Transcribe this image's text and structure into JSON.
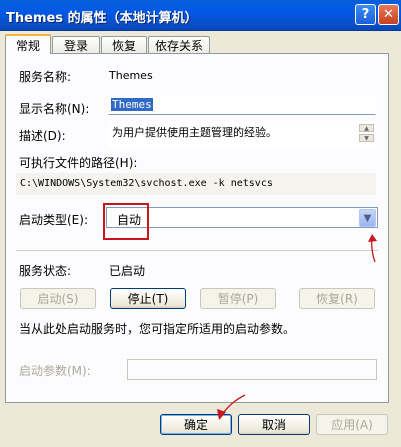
{
  "window": {
    "title": "Themes 的属性（本地计算机）",
    "help_glyph": "?",
    "close_glyph": "✕"
  },
  "tabs": [
    {
      "label": "常规",
      "active": true
    },
    {
      "label": "登录",
      "active": false
    },
    {
      "label": "恢复",
      "active": false
    },
    {
      "label": "依存关系",
      "active": false
    }
  ],
  "general": {
    "service_name_label": "服务名称:",
    "service_name_value": "Themes",
    "display_name_label": "显示名称(N):",
    "display_name_value": "Themes",
    "description_label": "描述(D):",
    "description_value": "为用户提供使用主题管理的经验。",
    "exe_path_label": "可执行文件的路径(H):",
    "exe_path_value": "C:\\WINDOWS\\System32\\svchost.exe -k netsvcs",
    "startup_type_label": "启动类型(E):",
    "startup_type_value": "自动",
    "service_status_label": "服务状态:",
    "service_status_value": "已启动",
    "start_button": "启动(S)",
    "stop_button": "停止(T)",
    "pause_button": "暂停(P)",
    "resume_button": "恢复(R)",
    "hint_text": "当从此处启动服务时，您可指定所适用的启动参数。",
    "start_params_label": "启动参数(M):",
    "start_params_value": ""
  },
  "footer": {
    "ok_button": "确定",
    "cancel_button": "取消",
    "apply_button": "应用(A)"
  },
  "annotation_color": "#c8161e"
}
